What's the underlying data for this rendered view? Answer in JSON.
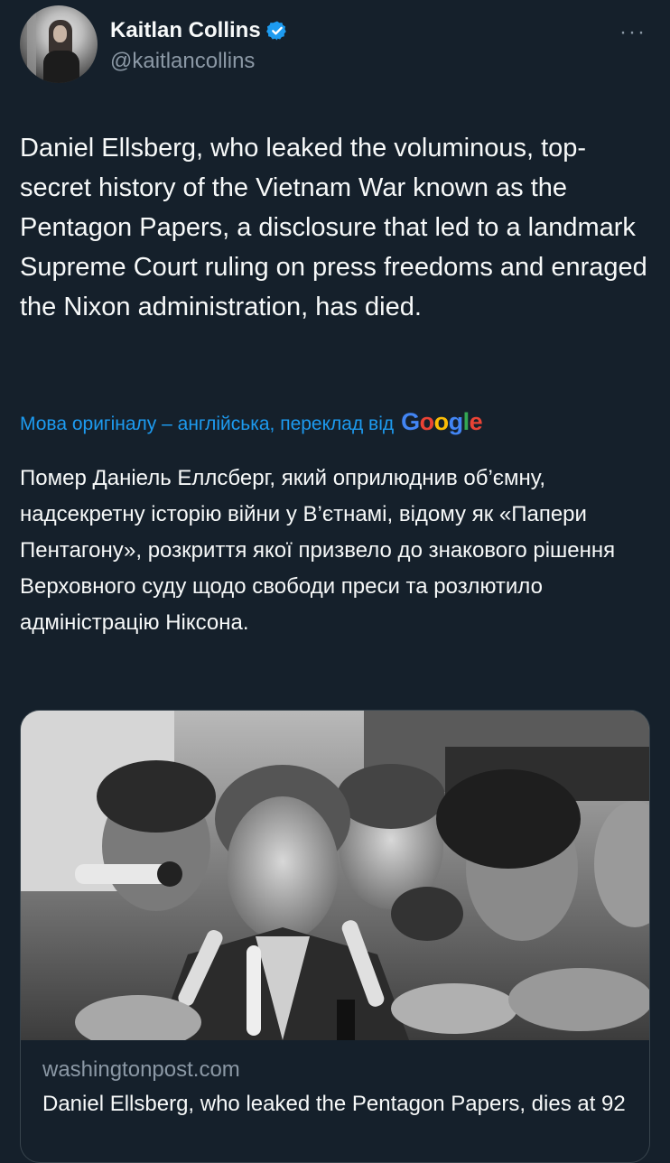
{
  "author": {
    "display_name": "Kaitlan Collins",
    "handle": "@kaitlancollins",
    "verified_icon": "verified-badge-icon",
    "more_label": "···"
  },
  "tweet": {
    "text": "Daniel Ellsberg, who leaked the voluminous, top-secret history of the Vietnam War known as the Pentagon Papers, a disclosure that led to a landmark Supreme Court ruling on press freedoms and enraged the Nixon administration, has died."
  },
  "translation": {
    "note": "Мова оригіналу – англійська, переклад від",
    "provider": "Google",
    "text": "Помер Даніель Еллсберг, який оприлюднив об’ємну, надсекретну історію війни у В’єтнамі, відому як «Папери Пентагону», розкриття якої призвело до знакового рішення Верховного суду щодо свободи преси та розлютило адміністрацію Ніксона."
  },
  "link_card": {
    "domain": "washingtonpost.com",
    "title": "Daniel Ellsberg, who leaked the Pentagon Papers, dies at 92",
    "image_icon": "press-photo"
  },
  "colors": {
    "background": "#15202b",
    "link": "#1d9bf0",
    "muted": "#8b98a5",
    "verified": "#1d9bf0"
  }
}
